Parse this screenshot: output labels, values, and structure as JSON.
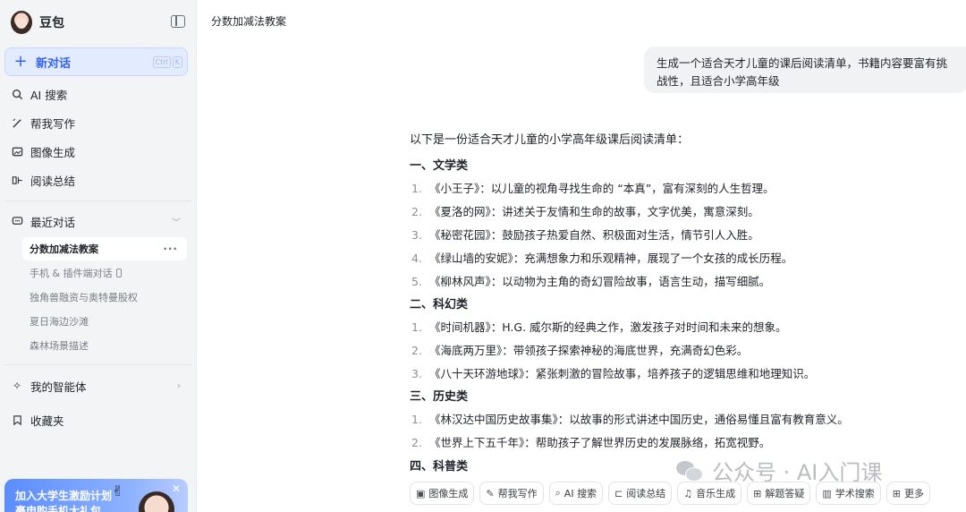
{
  "sidebar": {
    "brand": "豆包",
    "new_chat": "新对话",
    "shortcut": [
      "Ctrl",
      "K"
    ],
    "nav": [
      {
        "label": "AI 搜索",
        "icon": "search-sparkle-icon"
      },
      {
        "label": "帮我写作",
        "icon": "pen-icon"
      },
      {
        "label": "图像生成",
        "icon": "image-icon"
      },
      {
        "label": "阅读总结",
        "icon": "read-icon"
      }
    ],
    "recent_label": "最近对话",
    "history": [
      {
        "label": "分数加减法教案",
        "active": true
      },
      {
        "label": "手机 & 插件端对话"
      },
      {
        "label": "独角兽融资与奥特曼股权"
      },
      {
        "label": "夏日海边沙滩"
      },
      {
        "label": "森林场景描述"
      }
    ],
    "agents_label": "我的智能体",
    "favorites_label": "收藏夹",
    "promo": {
      "title": "加入大学生激励计划",
      "subtitle": "豪申购手机大礼包"
    }
  },
  "main": {
    "title": "分数加减法教案",
    "user_message": "生成一个适合天才儿童的课后阅读清单，书籍内容要富有挑战性，且适合小学高年级",
    "answer": {
      "intro": "以下是一份适合天才儿童的小学高年级课后阅读清单：",
      "sections": [
        {
          "heading": "一、文学类",
          "items": [
            "《小王子》：以儿童的视角寻找生命的 “本真”，富有深刻的人生哲理。",
            "《夏洛的网》：讲述关于友情和生命的故事，文字优美，寓意深刻。",
            "《秘密花园》：鼓励孩子热爱自然、积极面对生活，情节引人入胜。",
            "《绿山墙的安妮》：充满想象力和乐观精神，展现了一个女孩的成长历程。",
            "《柳林风声》：以动物为主角的奇幻冒险故事，语言生动，描写细腻。"
          ]
        },
        {
          "heading": "二、科幻类",
          "items": [
            "《时间机器》：H.G. 威尔斯的经典之作，激发孩子对时间和未来的想象。",
            "《海底两万里》：带领孩子探索神秘的海底世界，充满奇幻色彩。",
            "《八十天环游地球》：紧张刺激的冒险故事，培养孩子的逻辑思维和地理知识。"
          ]
        },
        {
          "heading": "三、历史类",
          "items": [
            "《林汉达中国历史故事集》：以故事的形式讲述中国历史，通俗易懂且富有教育意义。",
            "《世界上下五千年》：帮助孩子了解世界历史的发展脉络，拓宽视野。"
          ]
        },
        {
          "heading": "四、科普类",
          "items": []
        }
      ]
    },
    "watermark": "公众号 · AI入门课",
    "tools": [
      {
        "label": "图像生成",
        "icon": "image-icon"
      },
      {
        "label": "帮我写作",
        "icon": "pen-icon"
      },
      {
        "label": "AI 搜索",
        "icon": "search-sparkle-icon"
      },
      {
        "label": "阅读总结",
        "icon": "read-icon"
      },
      {
        "label": "音乐生成",
        "icon": "music-icon"
      },
      {
        "label": "解题答疑",
        "icon": "solve-icon"
      },
      {
        "label": "学术搜索",
        "icon": "chart-icon"
      },
      {
        "label": "更多",
        "icon": "grid-icon"
      }
    ]
  },
  "colors": {
    "accent": "#3264f0",
    "sidebar_bg": "#f3f4f6",
    "bubble_bg": "#f1f2f4"
  }
}
